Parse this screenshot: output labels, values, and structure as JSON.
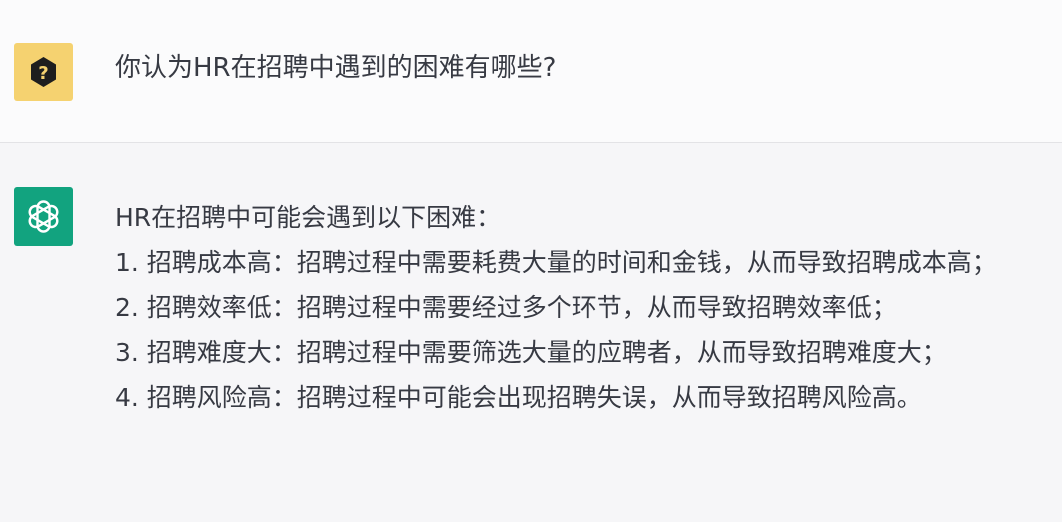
{
  "colors": {
    "user_bg": "#fbfbfc",
    "assistant_bg": "#f6f6f8",
    "user_avatar_bg": "#f5d270",
    "assistant_avatar_bg": "#12a37f",
    "text": "#373a43"
  },
  "user_message": {
    "avatar_icon": "question-mark-hexagon-icon",
    "text": "你认为HR在招聘中遇到的困难有哪些?"
  },
  "assistant_message": {
    "avatar_icon": "openai-logo-icon",
    "intro": "HR在招聘中可能会遇到以下困难：",
    "items": [
      "1. 招聘成本高：招聘过程中需要耗费大量的时间和金钱，从而导致招聘成本高；",
      "2. 招聘效率低：招聘过程中需要经过多个环节，从而导致招聘效率低；",
      "3. 招聘难度大：招聘过程中需要筛选大量的应聘者，从而导致招聘难度大；",
      "4. 招聘风险高：招聘过程中可能会出现招聘失误，从而导致招聘风险高。"
    ]
  }
}
